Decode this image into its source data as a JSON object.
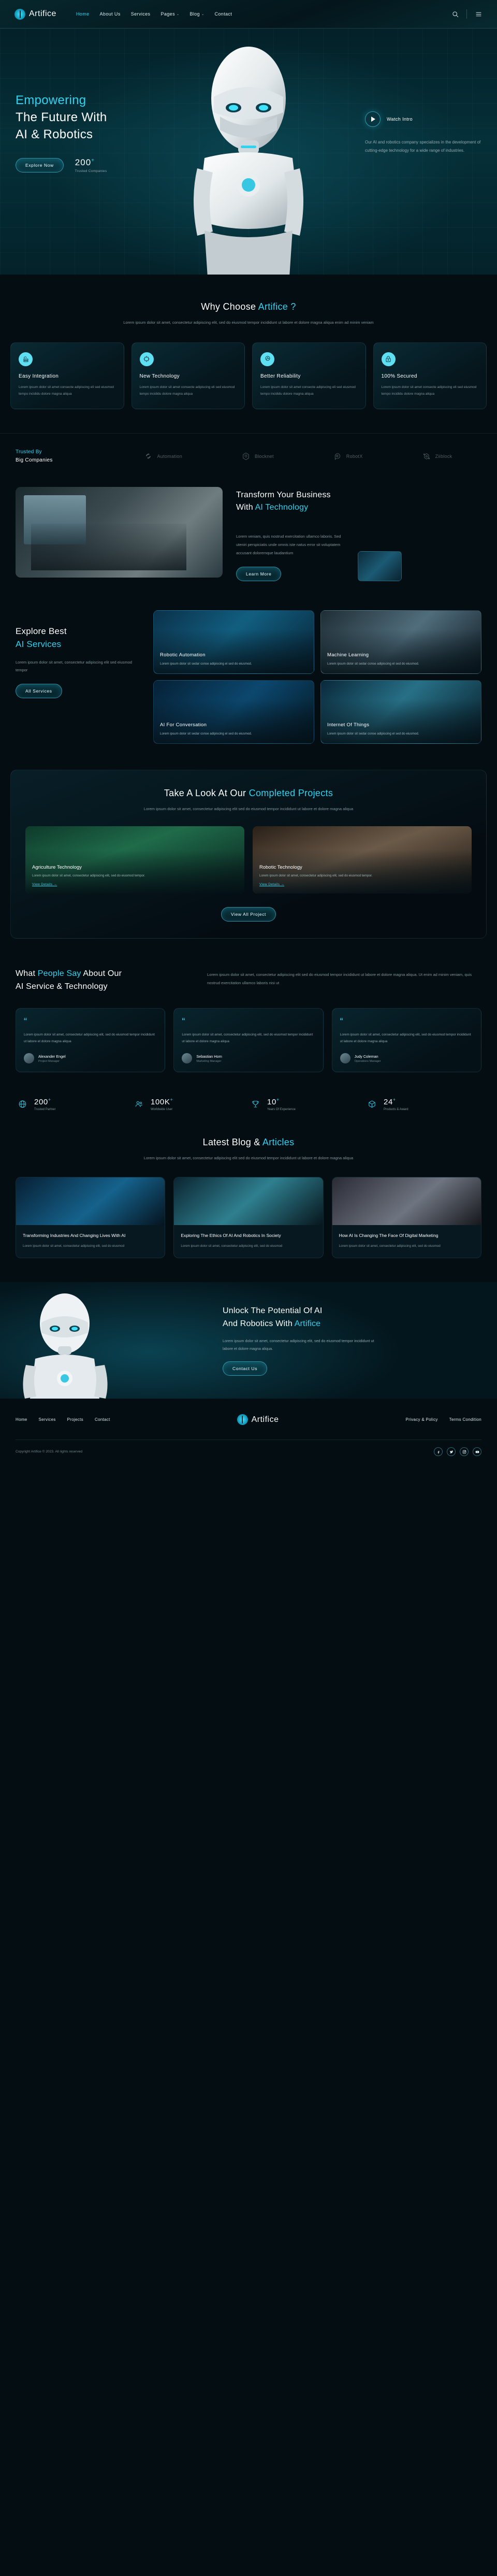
{
  "brand": {
    "name": "Artifice",
    "accent": "#2ed3f0"
  },
  "header": {
    "nav": [
      {
        "label": "Home",
        "active": true,
        "caret": ""
      },
      {
        "label": "About Us",
        "active": false,
        "caret": ""
      },
      {
        "label": "Services",
        "active": false,
        "caret": ""
      },
      {
        "label": "Pages",
        "active": false,
        "caret": "⌄"
      },
      {
        "label": "Blog",
        "active": false,
        "caret": "⌄"
      },
      {
        "label": "Contact",
        "active": false,
        "caret": ""
      }
    ],
    "search_icon": "search-icon",
    "menu_icon": "hamburger-menu-icon"
  },
  "hero": {
    "line1": "Empowering",
    "line2": "The Future With",
    "line3": "AI & Robotics",
    "cta": "Explore Now",
    "stat_number": "200",
    "stat_plus": "+",
    "stat_caption": "Trusted Companies",
    "watch_label": "Watch Intro",
    "description": "Our AI and robotics company specializes in the development of cutting-edge technology for a wide range of industries."
  },
  "why": {
    "title_plain": "Why Choose ",
    "title_accent": "Artifice ?",
    "subtitle": "Lorem ipsum dolor sit amet, consectetur adipiscing elit, sed do eiusmod tempor incididunt ut labore et dolore magna aliqua enim ad minim veniam",
    "cards": [
      {
        "icon": "cloud-server-icon",
        "glyph": "☁",
        "title": "Easy Integration",
        "text": "Lorem ipsum dolor sit amet consecte adipiscing eli sed eiusmod tempo incididu dolore magna aliqua"
      },
      {
        "icon": "network-chip-icon",
        "glyph": "⌗",
        "title": "New Technology",
        "text": "Lorem ipsum dolor sit amet consecte adipiscing eli sed eiusmod tempo incididu dolore magna aliqua"
      },
      {
        "icon": "badge-thumbsup-icon",
        "glyph": "★",
        "title": "Better Reliability",
        "text": "Lorem ipsum dolor sit amet consecte adipiscing eli sed eiusmod tempo incididu dolore magna aliqua"
      },
      {
        "icon": "lock-icon",
        "glyph": "ὑ2",
        "title": "100% Secured",
        "text": "Lorem ipsum dolor sit amet consecte adipiscing eli sed eiusmod tempo incididu dolore magna aliqua"
      }
    ]
  },
  "trusted": {
    "label_line1": "Trusted By",
    "label_line2": "Big Companies",
    "brands": [
      {
        "name": "Automation",
        "icon": "recycle-arrows-icon",
        "glyph": "⟳"
      },
      {
        "name": "Blocknet",
        "icon": "hexagon-node-icon",
        "glyph": "⬡"
      },
      {
        "name": "RobotX",
        "icon": "robot-head-icon",
        "glyph": "◎"
      },
      {
        "name": "Ziiblock",
        "icon": "atom-block-icon",
        "glyph": "⬢"
      }
    ]
  },
  "transform": {
    "title_l1": "Transform Your Business",
    "title_l2_plain": "With ",
    "title_l2_accent": "AI Technology",
    "text": "Lorem veniam, quis nostrud exercitation ullamco laboris. Sed uteniri perspiciatis unde omnis iste natus error sit voluptatem accusant doloremque laudantium",
    "button": "Learn More",
    "image_alt": "engineers-in-lab-photo",
    "thumb_alt": "laptop-ai-thumbnail"
  },
  "explore": {
    "title_l1": "Explore Best",
    "title_l2": "AI Services",
    "text": "Lorem ipsum dolor sit amet, consectetur adipiscing elit sed eiusmod tempor",
    "button": "All Services",
    "cards": [
      {
        "title": "Robotic Automation",
        "text": "Lorem ipsum dolor sit sedar conse adipiscing el sed do eiusmod.",
        "image": "robotic-arm-photo"
      },
      {
        "title": "Machine Learning",
        "text": "Lorem ipsum dolor sit sedar conse adipiscing el sed do eiusmod.",
        "image": "tablet-ai-photo"
      },
      {
        "title": "AI For Conversation",
        "text": "Lorem ipsum dolor sit sedar conse adipiscing el sed do eiusmod.",
        "image": "ai-brain-photo"
      },
      {
        "title": "Internet Of Things",
        "text": "Lorem ipsum dolor sit sedar conse adipiscing el sed do eiusmod.",
        "image": "woman-vr-photo"
      }
    ]
  },
  "projects": {
    "title_plain": "Take A Look At Our ",
    "title_accent": "Completed Projects",
    "subtitle": "Lorem ipsum dolor sit amet, consectetur adipiscing elit sed do eiusmod tempor incididunt ut labore et dolore magna aliqua",
    "cards": [
      {
        "title": "Agriculture Technology",
        "text": "Lorem ipsum dolor sit amet, consectetur adipiscing elit, sed do eiusmod tempor.",
        "link": "View Details →",
        "image": "vertical-farming-photo"
      },
      {
        "title": "Robotic Technology",
        "text": "Lorem ipsum dolor sit amet, consectetur adipiscing elit, sed do eiusmod tempor.",
        "link": "View Details →",
        "image": "woman-engineer-photo"
      }
    ],
    "button": "View All Project"
  },
  "testimonials": {
    "title_l1_plain_a": "What ",
    "title_l1_accent": "People Say",
    "title_l1_plain_b": " About Our",
    "title_l2": "AI Service & Technology",
    "intro": "Lorem ipsum dolor sit amet, consectetur adipiscing elit sed do eiusmod tempor incididunt ut labore et dolore magna aliqua. Ut enim ad minim veniam, quis nostrud exercitation ullamco laboris nisi ut",
    "cards": [
      {
        "quote_mark": "“",
        "text": "Lorem ipsum dolor sit amet, consectetur adipiscing elit, sed do eiusmod tempor incididunt ut labore et dolore magna aliqua",
        "name": "Alexander Engel",
        "role": "Project Manager"
      },
      {
        "quote_mark": "“",
        "text": "Lorem ipsum dolor sit amet, consectetur adipiscing elit, sed do eiusmod tempor incididunt ut labore et dolore magna aliqua",
        "name": "Sebastian Horn",
        "role": "Marketing Manager"
      },
      {
        "quote_mark": "“",
        "text": "Lorem ipsum dolor sit amet, consectetur adipiscing elit, sed do eiusmod tempor incididunt ut labore et dolore magna aliqua",
        "name": "Judy Coleman",
        "role": "Operations Manager"
      }
    ]
  },
  "counters": [
    {
      "icon": "globe-icon",
      "glyph": "◎",
      "number": "200",
      "plus": "+",
      "caption": "Trusted Partner"
    },
    {
      "icon": "users-icon",
      "glyph": "♟",
      "number": "100K",
      "plus": "+",
      "caption": "Worldwide User"
    },
    {
      "icon": "trophy-icon",
      "glyph": "⚑",
      "number": "10",
      "plus": "+",
      "caption": "Years Of Experience"
    },
    {
      "icon": "box-icon",
      "glyph": "⬚",
      "number": "24",
      "plus": "+",
      "caption": "Products & Award"
    }
  ],
  "blog": {
    "title_plain": "Latest Blog & ",
    "title_accent": "Articles",
    "subtitle": "Lorem ipsum dolor sit amet, consectetur adipiscing elit sed do eiusmod tempor incididunt ut labore et dolore magna aliqua",
    "cards": [
      {
        "title": "Transforming Industries And Changing Lives With AI",
        "text": "Lorem ipsum dolor sit amet, consectetur adipiscing elit, sed do eiusmod",
        "image": "ai-network-photo"
      },
      {
        "title": "Exploring The Ethics Of AI And Robotics In Society",
        "text": "Lorem ipsum dolor sit amet, consectetur adipiscing elit, sed do eiusmod",
        "image": "engineer-robot-photo"
      },
      {
        "title": "How AI Is Changing The Face Of Digital Marketing",
        "text": "Lorem ipsum dolor sit amet, consectetur adipiscing elit, sed do eiusmod",
        "image": "two-people-photo"
      }
    ]
  },
  "cta": {
    "title_l1": "Unlock The Potential Of AI",
    "title_l2_plain": "And Robotics With ",
    "title_l2_accent": "Artifice",
    "text": "Lorem ipsum dolor sit amet, consectetur adipiscing elit, sed do eiusmod tempor incididunt ut labore et dolore magna aliqua.",
    "button": "Contact Us"
  },
  "footer": {
    "links": [
      "Home",
      "Services",
      "Projects",
      "Contact"
    ],
    "legal": [
      "Privacy & Policy",
      "Terms Condition"
    ],
    "logo": "Artifice",
    "copyright": "Copyright Artifice © 2023. All rights reserved",
    "socials": [
      {
        "name": "facebook-icon",
        "glyph": "f"
      },
      {
        "name": "twitter-icon",
        "glyph": "ᴠ"
      },
      {
        "name": "instagram-icon",
        "glyph": "▣"
      },
      {
        "name": "youtube-icon",
        "glyph": "▶"
      }
    ]
  }
}
